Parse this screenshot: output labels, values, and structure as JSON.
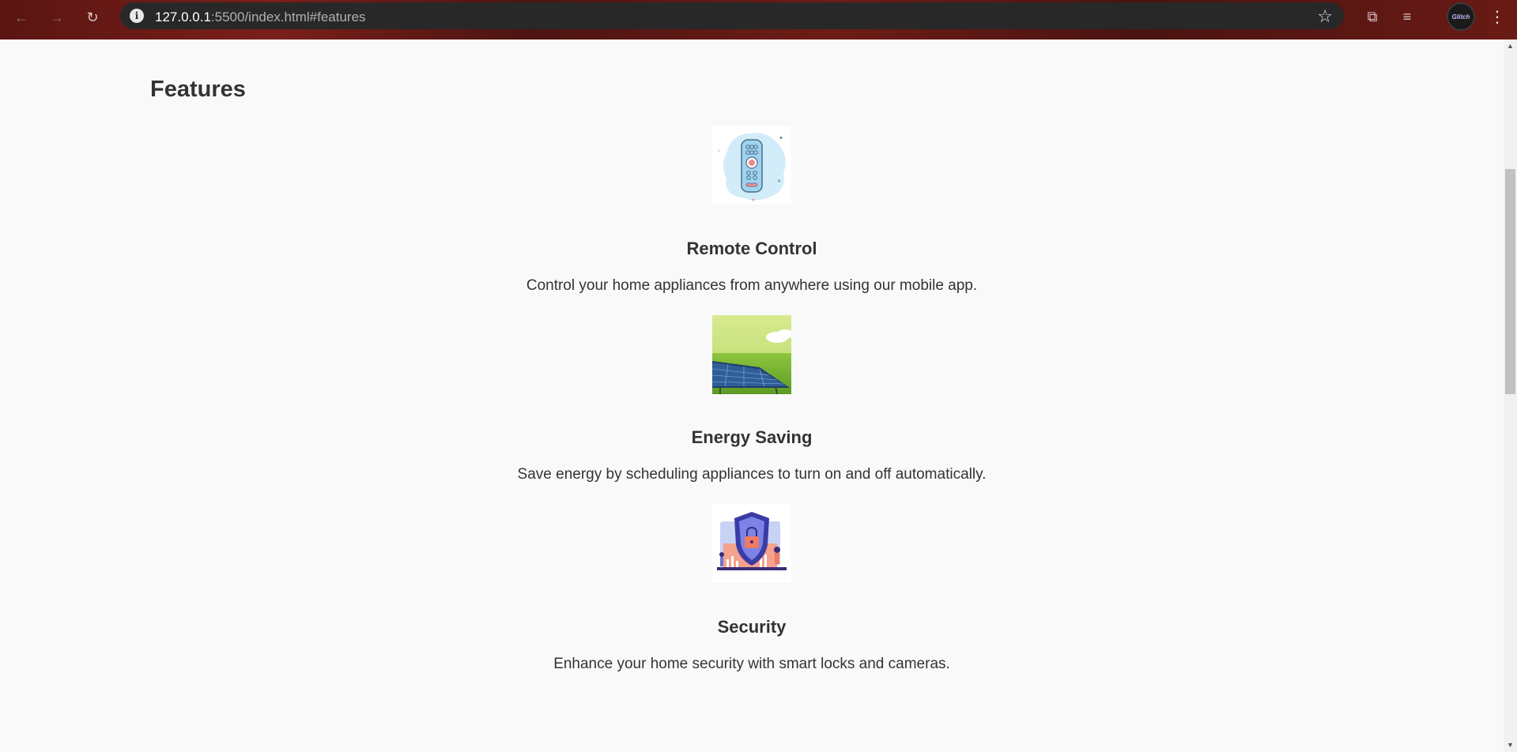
{
  "browser": {
    "url_host": "127.0.0.1",
    "url_rest": ":5500/index.html#features",
    "back_icon": "←",
    "forward_icon": "→",
    "reload_icon": "↻",
    "info_icon": "i",
    "star_icon": "☆",
    "extensions_icon": "⧉",
    "media_icon": "≡",
    "menu_icon": "⋮",
    "profile_label": "Glitch"
  },
  "page": {
    "section_title": "Features",
    "features": [
      {
        "title": "Remote Control",
        "description": "Control your home appliances from anywhere using our mobile app.",
        "icon": "remote-control-image"
      },
      {
        "title": "Energy Saving",
        "description": "Save energy by scheduling appliances to turn on and off automatically.",
        "icon": "solar-panel-image"
      },
      {
        "title": "Security",
        "description": "Enhance your home security with smart locks and cameras.",
        "icon": "security-shield-image"
      }
    ]
  },
  "colors": {
    "page_background": "#f9f9f9",
    "text": "#333333",
    "chrome_frame": "#5a1512",
    "omnibox": "#282828"
  }
}
